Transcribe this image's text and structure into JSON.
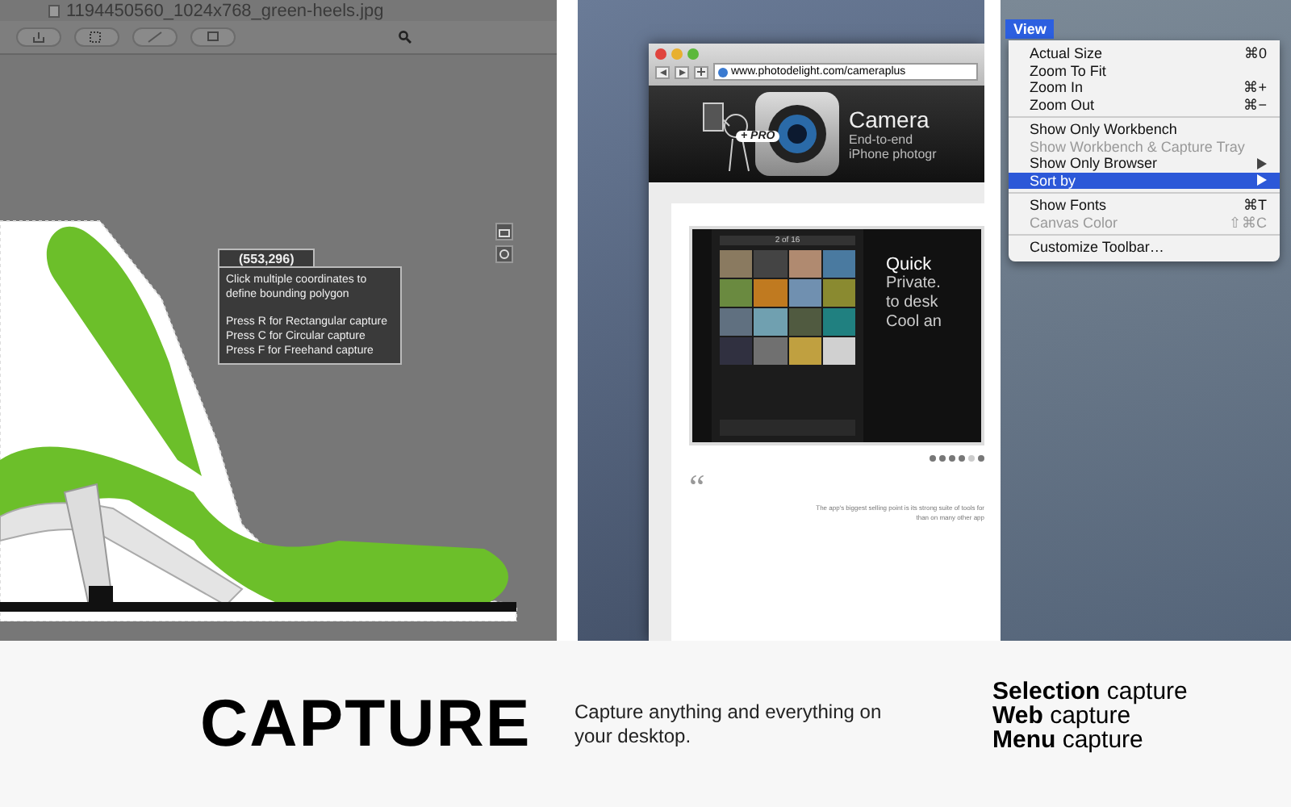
{
  "capture_panel": {
    "file_name": "1194450560_1024x768_green-heels.jpg",
    "coordinates": "(553,296)",
    "help_paragraphs": [
      [
        "Click multiple coordinates to",
        "define bounding polygon"
      ],
      [
        "Press R for Rectangular capture",
        "Press C for Circular capture",
        "Press F for Freehand capture"
      ]
    ]
  },
  "web_panel": {
    "url": "www.photodelight.com/cameraplus",
    "badge": "+ PRO",
    "app_name": "Camera",
    "tagline_lines": [
      "End-to-end",
      "iPhone photogr"
    ],
    "phone_counter": "2 of 16",
    "promo_lines": [
      "Quick",
      "Private.",
      "to desk",
      "Cool an"
    ],
    "pager_dots": [
      {
        "selected": false
      },
      {
        "selected": false
      },
      {
        "selected": false
      },
      {
        "selected": false
      },
      {
        "selected": true
      },
      {
        "selected": false
      }
    ],
    "quote_mark": "“",
    "quote_lines": [
      "The app's biggest selling point is its strong suite of tools for",
      "than on many other app"
    ]
  },
  "menu_panel": {
    "menu_title": "View",
    "items": [
      {
        "kind": "item",
        "label": "Actual Size",
        "shortcut": "⌘0",
        "disabled": false,
        "selected": false,
        "submenu": false
      },
      {
        "kind": "item",
        "label": "Zoom To Fit",
        "disabled": false,
        "selected": false,
        "submenu": false
      },
      {
        "kind": "item",
        "label": "Zoom In",
        "shortcut": "⌘+",
        "disabled": false,
        "selected": false,
        "submenu": false
      },
      {
        "kind": "item",
        "label": "Zoom Out",
        "shortcut": "⌘−",
        "disabled": false,
        "selected": false,
        "submenu": false
      },
      {
        "kind": "separator"
      },
      {
        "kind": "item",
        "label": "Show Only Workbench",
        "disabled": false,
        "selected": false,
        "submenu": false
      },
      {
        "kind": "item",
        "label": "Show Workbench & Capture Tray",
        "disabled": true,
        "selected": false,
        "submenu": false
      },
      {
        "kind": "item",
        "label": "Show Only Browser",
        "disabled": false,
        "selected": false,
        "submenu": true
      },
      {
        "kind": "item",
        "label": "Sort by",
        "disabled": false,
        "selected": true,
        "submenu": true
      },
      {
        "kind": "separator"
      },
      {
        "kind": "item",
        "label": "Show Fonts",
        "shortcut": "⌘T",
        "disabled": false,
        "selected": false,
        "submenu": false
      },
      {
        "kind": "item",
        "label": "Canvas Color",
        "shortcut": "⇧⌘C",
        "disabled": true,
        "selected": false,
        "submenu": false
      },
      {
        "kind": "separator"
      },
      {
        "kind": "item",
        "label": "Customize Toolbar…",
        "disabled": false,
        "selected": false,
        "submenu": false
      }
    ]
  },
  "footer": {
    "heading": "CAPTURE",
    "description": "Capture anything and everything on your desktop.",
    "features": [
      "**Selection** capture",
      "**Web** capture",
      "**Menu** capture"
    ]
  }
}
